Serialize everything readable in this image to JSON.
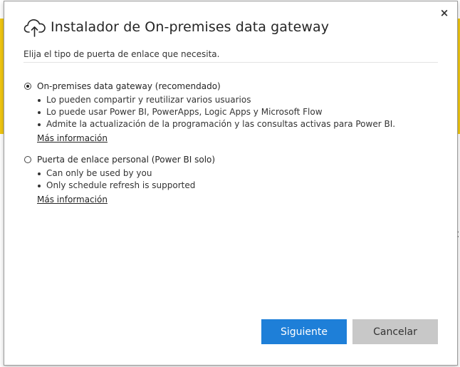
{
  "dialog": {
    "title": "Instalador de On-premises data gateway",
    "close_label": "×",
    "subtitle": "Elija el tipo de puerta de enlace que necesita."
  },
  "options": [
    {
      "label": "On-premises data gateway (recomendado)",
      "selected": true,
      "bullets": [
        "Lo pueden compartir y reutilizar varios usuarios",
        "Lo puede usar Power BI, PowerApps, Logic Apps y Microsoft Flow",
        "Admite la actualización de la programación y las consultas activas para Power BI."
      ],
      "link": "Más información"
    },
    {
      "label": "Puerta de enlace personal (Power BI solo)",
      "selected": false,
      "bullets": [
        "Can only be used by you",
        "Only schedule refresh is supported"
      ],
      "link": "Más información"
    }
  ],
  "buttons": {
    "next_label": "Siguiente",
    "cancel_label": "Cancelar"
  },
  "colors": {
    "primary_button": "#1e7fd8",
    "secondary_button": "#c8c8c8",
    "background_app": "#f2c811"
  },
  "icons": {
    "title_icon": "cloud-upload-icon",
    "close_icon": "close-icon"
  }
}
